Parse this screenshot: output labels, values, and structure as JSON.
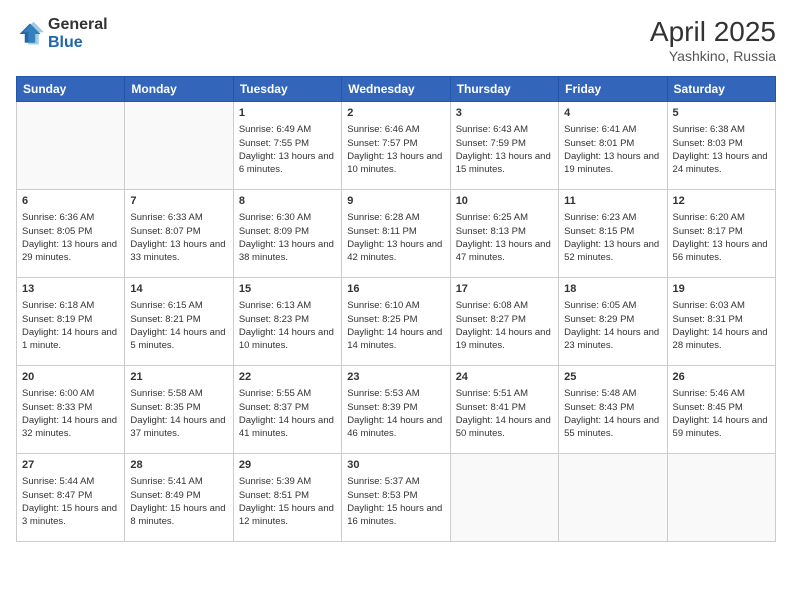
{
  "header": {
    "logo_general": "General",
    "logo_blue": "Blue",
    "title": "April 2025",
    "subtitle": "Yashkino, Russia"
  },
  "days_of_week": [
    "Sunday",
    "Monday",
    "Tuesday",
    "Wednesday",
    "Thursday",
    "Friday",
    "Saturday"
  ],
  "weeks": [
    [
      {
        "day": "",
        "info": ""
      },
      {
        "day": "",
        "info": ""
      },
      {
        "day": "1",
        "info": "Sunrise: 6:49 AM\nSunset: 7:55 PM\nDaylight: 13 hours and 6 minutes."
      },
      {
        "day": "2",
        "info": "Sunrise: 6:46 AM\nSunset: 7:57 PM\nDaylight: 13 hours and 10 minutes."
      },
      {
        "day": "3",
        "info": "Sunrise: 6:43 AM\nSunset: 7:59 PM\nDaylight: 13 hours and 15 minutes."
      },
      {
        "day": "4",
        "info": "Sunrise: 6:41 AM\nSunset: 8:01 PM\nDaylight: 13 hours and 19 minutes."
      },
      {
        "day": "5",
        "info": "Sunrise: 6:38 AM\nSunset: 8:03 PM\nDaylight: 13 hours and 24 minutes."
      }
    ],
    [
      {
        "day": "6",
        "info": "Sunrise: 6:36 AM\nSunset: 8:05 PM\nDaylight: 13 hours and 29 minutes."
      },
      {
        "day": "7",
        "info": "Sunrise: 6:33 AM\nSunset: 8:07 PM\nDaylight: 13 hours and 33 minutes."
      },
      {
        "day": "8",
        "info": "Sunrise: 6:30 AM\nSunset: 8:09 PM\nDaylight: 13 hours and 38 minutes."
      },
      {
        "day": "9",
        "info": "Sunrise: 6:28 AM\nSunset: 8:11 PM\nDaylight: 13 hours and 42 minutes."
      },
      {
        "day": "10",
        "info": "Sunrise: 6:25 AM\nSunset: 8:13 PM\nDaylight: 13 hours and 47 minutes."
      },
      {
        "day": "11",
        "info": "Sunrise: 6:23 AM\nSunset: 8:15 PM\nDaylight: 13 hours and 52 minutes."
      },
      {
        "day": "12",
        "info": "Sunrise: 6:20 AM\nSunset: 8:17 PM\nDaylight: 13 hours and 56 minutes."
      }
    ],
    [
      {
        "day": "13",
        "info": "Sunrise: 6:18 AM\nSunset: 8:19 PM\nDaylight: 14 hours and 1 minute."
      },
      {
        "day": "14",
        "info": "Sunrise: 6:15 AM\nSunset: 8:21 PM\nDaylight: 14 hours and 5 minutes."
      },
      {
        "day": "15",
        "info": "Sunrise: 6:13 AM\nSunset: 8:23 PM\nDaylight: 14 hours and 10 minutes."
      },
      {
        "day": "16",
        "info": "Sunrise: 6:10 AM\nSunset: 8:25 PM\nDaylight: 14 hours and 14 minutes."
      },
      {
        "day": "17",
        "info": "Sunrise: 6:08 AM\nSunset: 8:27 PM\nDaylight: 14 hours and 19 minutes."
      },
      {
        "day": "18",
        "info": "Sunrise: 6:05 AM\nSunset: 8:29 PM\nDaylight: 14 hours and 23 minutes."
      },
      {
        "day": "19",
        "info": "Sunrise: 6:03 AM\nSunset: 8:31 PM\nDaylight: 14 hours and 28 minutes."
      }
    ],
    [
      {
        "day": "20",
        "info": "Sunrise: 6:00 AM\nSunset: 8:33 PM\nDaylight: 14 hours and 32 minutes."
      },
      {
        "day": "21",
        "info": "Sunrise: 5:58 AM\nSunset: 8:35 PM\nDaylight: 14 hours and 37 minutes."
      },
      {
        "day": "22",
        "info": "Sunrise: 5:55 AM\nSunset: 8:37 PM\nDaylight: 14 hours and 41 minutes."
      },
      {
        "day": "23",
        "info": "Sunrise: 5:53 AM\nSunset: 8:39 PM\nDaylight: 14 hours and 46 minutes."
      },
      {
        "day": "24",
        "info": "Sunrise: 5:51 AM\nSunset: 8:41 PM\nDaylight: 14 hours and 50 minutes."
      },
      {
        "day": "25",
        "info": "Sunrise: 5:48 AM\nSunset: 8:43 PM\nDaylight: 14 hours and 55 minutes."
      },
      {
        "day": "26",
        "info": "Sunrise: 5:46 AM\nSunset: 8:45 PM\nDaylight: 14 hours and 59 minutes."
      }
    ],
    [
      {
        "day": "27",
        "info": "Sunrise: 5:44 AM\nSunset: 8:47 PM\nDaylight: 15 hours and 3 minutes."
      },
      {
        "day": "28",
        "info": "Sunrise: 5:41 AM\nSunset: 8:49 PM\nDaylight: 15 hours and 8 minutes."
      },
      {
        "day": "29",
        "info": "Sunrise: 5:39 AM\nSunset: 8:51 PM\nDaylight: 15 hours and 12 minutes."
      },
      {
        "day": "30",
        "info": "Sunrise: 5:37 AM\nSunset: 8:53 PM\nDaylight: 15 hours and 16 minutes."
      },
      {
        "day": "",
        "info": ""
      },
      {
        "day": "",
        "info": ""
      },
      {
        "day": "",
        "info": ""
      }
    ]
  ]
}
